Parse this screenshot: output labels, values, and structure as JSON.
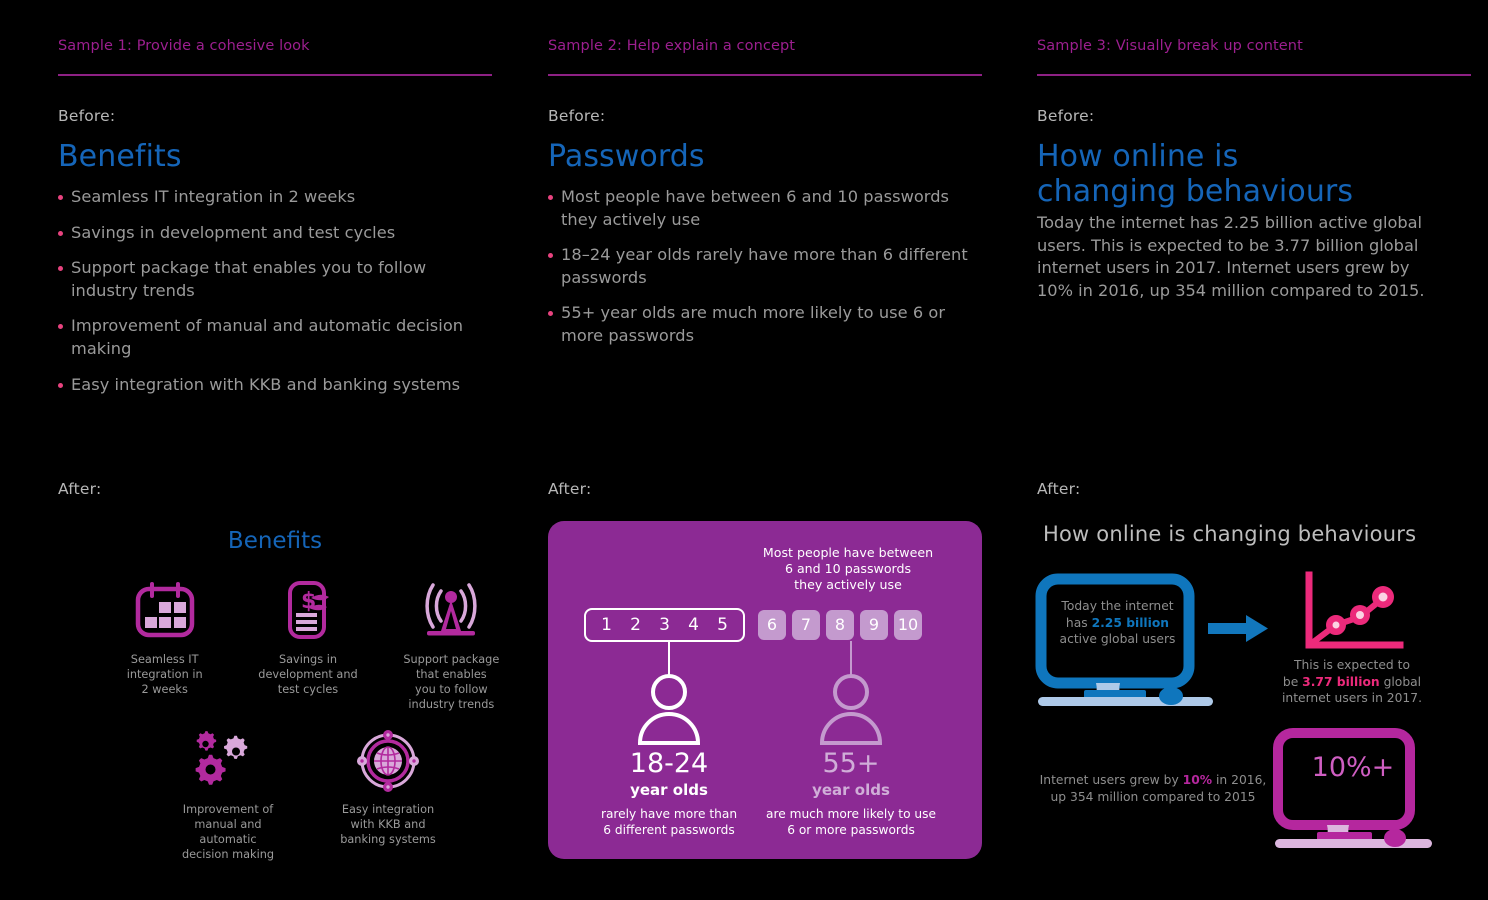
{
  "theme": {
    "background": "#000000",
    "accent_magenta": "#9c1f8f",
    "accent_pink": "#e8437f",
    "heading_blue": "#1565b8",
    "body_grey": "#9a9a9a",
    "card_purple": "#8c2a94",
    "card_light_purple": "#c49ace",
    "monitor_blue": "#0f76bd",
    "chart_pink": "#ec2a7b"
  },
  "columns": [
    {
      "sample_title": "Sample 1: Provide a cohesive look",
      "before_label": "Before:",
      "after_label": "After:",
      "heading": "Benefits",
      "bullets": [
        "Seamless IT integration in 2 weeks",
        "Savings in development and test cycles",
        "Support package that enables you to follow industry trends",
        "Improvement of manual and automatic decision making",
        "Easy integration with KKB and banking systems"
      ],
      "after": {
        "title": "Benefits",
        "icons": [
          {
            "icon": "calendar-icon",
            "caption": "Seamless IT\nintegration in\n2 weeks"
          },
          {
            "icon": "invoice-dollar-icon",
            "caption": "Savings in\ndevelopment and\ntest cycles"
          },
          {
            "icon": "broadcast-tower-icon",
            "caption": "Support package\nthat enables\nyou to follow\nindustry trends"
          },
          {
            "icon": "gears-icon",
            "caption": "Improvement of\nmanual and\nautomatic\ndecision making"
          },
          {
            "icon": "globe-network-icon",
            "caption": "Easy integration\nwith KKB and\nbanking systems"
          }
        ]
      }
    },
    {
      "sample_title": "Sample 2: Help explain a concept",
      "before_label": "Before:",
      "after_label": "After:",
      "heading": "Passwords",
      "bullets": [
        "Most people have between 6 and 10 passwords they actively use",
        "18–24 year olds rarely have more than 6 different passwords",
        "55+ year olds are much more likely to use 6 or more passwords"
      ],
      "after": {
        "note": "Most people have between\n6 and 10 passwords\nthey actively use",
        "numbers_highlighted": [
          "1",
          "2",
          "3",
          "4",
          "5"
        ],
        "numbers_plain": [
          "6",
          "7",
          "8",
          "9",
          "10"
        ],
        "stats": [
          {
            "value": "18-24",
            "unit": "year olds",
            "description": "rarely have more than\n6 different passwords",
            "emphasis": "bright"
          },
          {
            "value": "55+",
            "unit": "year olds",
            "description": "are much more likely to use\n6 or more passwords",
            "emphasis": "dim"
          }
        ]
      }
    },
    {
      "sample_title": "Sample 3: Visually break up content",
      "before_label": "Before:",
      "after_label": "After:",
      "heading": "How online is\nchanging behaviours",
      "paragraph": "Today the internet has 2.25 billion active global users. This is expected to be 3.77 billion global internet users in 2017. Internet users grew by 10% in 2016, up 354 million compared to 2015.",
      "after": {
        "title": "How online is changing behaviours",
        "monitor_screen": {
          "prefix": "Today the internet\nhas ",
          "highlight": "2.25 billion",
          "suffix": "\nactive global users"
        },
        "chart_caption": {
          "prefix": "This is expected to\nbe ",
          "highlight": "3.77 billion",
          "suffix": " global\ninternet users in 2017."
        },
        "growth_caption": {
          "prefix": "Internet users grew by ",
          "highlight": "10%",
          "suffix": " in 2016,\nup 354 million compared to 2015"
        },
        "percent_screen": "10%+"
      }
    }
  ],
  "chart_data": {
    "type": "line",
    "title": "Internet users growth",
    "x": [
      1,
      2,
      3
    ],
    "values": [
      1,
      2,
      3
    ],
    "series": [
      {
        "name": "internet users",
        "values": [
          1,
          2,
          3
        ]
      }
    ],
    "xlabel": "",
    "ylabel": "",
    "grid": false,
    "legend": "none",
    "annotations": [
      "2.25 billion",
      "3.77 billion",
      "10%+",
      "354 million"
    ]
  }
}
